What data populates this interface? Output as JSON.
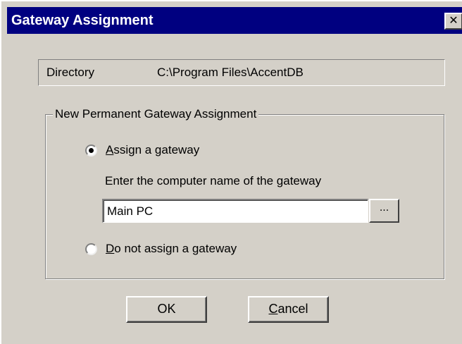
{
  "window": {
    "title": "Gateway Assignment",
    "close_glyph": "✕"
  },
  "directory": {
    "label": "Directory",
    "value": "C:\\Program Files\\AccentDB"
  },
  "group": {
    "legend": "New Permanent Gateway Assignment",
    "assign_option": {
      "mnemonic": "A",
      "rest": "ssign a gateway",
      "checked": true
    },
    "hint": "Enter the computer name of the gateway",
    "gateway_name_value": "Main PC",
    "browse_label": "...",
    "no_assign_option": {
      "mnemonic": "D",
      "rest": "o not assign a gateway",
      "checked": false
    }
  },
  "buttons": {
    "ok_label": "OK",
    "cancel_mnemonic": "C",
    "cancel_rest": "ancel"
  },
  "colors": {
    "titlebar": "#000080",
    "face": "#d4d0c8"
  }
}
